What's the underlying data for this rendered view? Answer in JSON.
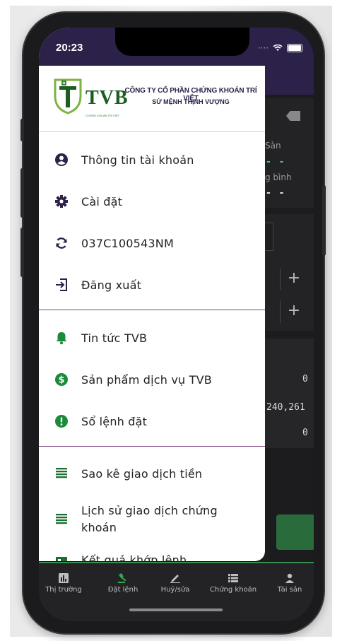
{
  "status_bar": {
    "time": "20:23"
  },
  "brand": {
    "logo_text": "TVB",
    "logo_subtext": "CHỨNG KHOÁN TRÍ VIỆT",
    "company_name": "CÔNG TY CỔ PHẦN CHỨNG KHOÁN TRÍ VIỆT",
    "slogan": "SỨ MỆNH THỊNH VƯỢNG"
  },
  "menu": {
    "account": [
      {
        "label": "Thông tin tài khoản",
        "icon": "account-circle-icon"
      },
      {
        "label": "Cài đặt",
        "icon": "gear-icon"
      },
      {
        "label": "037C100543NM",
        "icon": "sync-icon"
      },
      {
        "label": "Đăng xuất",
        "icon": "logout-icon"
      }
    ],
    "services": [
      {
        "label": "Tin tức TVB",
        "icon": "bell-icon"
      },
      {
        "label": "Sản phẩm dịch vụ TVB",
        "icon": "dollar-circle-icon"
      },
      {
        "label": "Sổ lệnh đặt",
        "icon": "alert-circle-icon"
      }
    ],
    "reports": [
      {
        "label": "Sao kê giao dịch tiền",
        "icon": "list-icon"
      },
      {
        "label": "Lịch sử giao dịch chứng khoán",
        "icon": "list-icon"
      },
      {
        "label": "Kết quả khớp lệnh",
        "icon": "report-icon"
      }
    ]
  },
  "background": {
    "san_label": "Sàn",
    "binh_label": "g bình",
    "dash": "- -",
    "value_0a": "0",
    "value_b": "240,261",
    "value_0c": "0"
  },
  "tabbar": {
    "items": [
      {
        "label": "Thị trường",
        "icon": "market-chart-icon"
      },
      {
        "label": "Đặt lệnh",
        "icon": "gavel-icon"
      },
      {
        "label": "Huỷ/sửa",
        "icon": "edit-icon"
      },
      {
        "label": "Chứng khoán",
        "icon": "stock-list-icon"
      },
      {
        "label": "Tài sản",
        "icon": "person-icon"
      }
    ]
  },
  "colors": {
    "header": "#2c2148",
    "accent_green": "#1b8a3a",
    "divider": "#7b3f7e",
    "icon_dark": "#2c2148"
  }
}
